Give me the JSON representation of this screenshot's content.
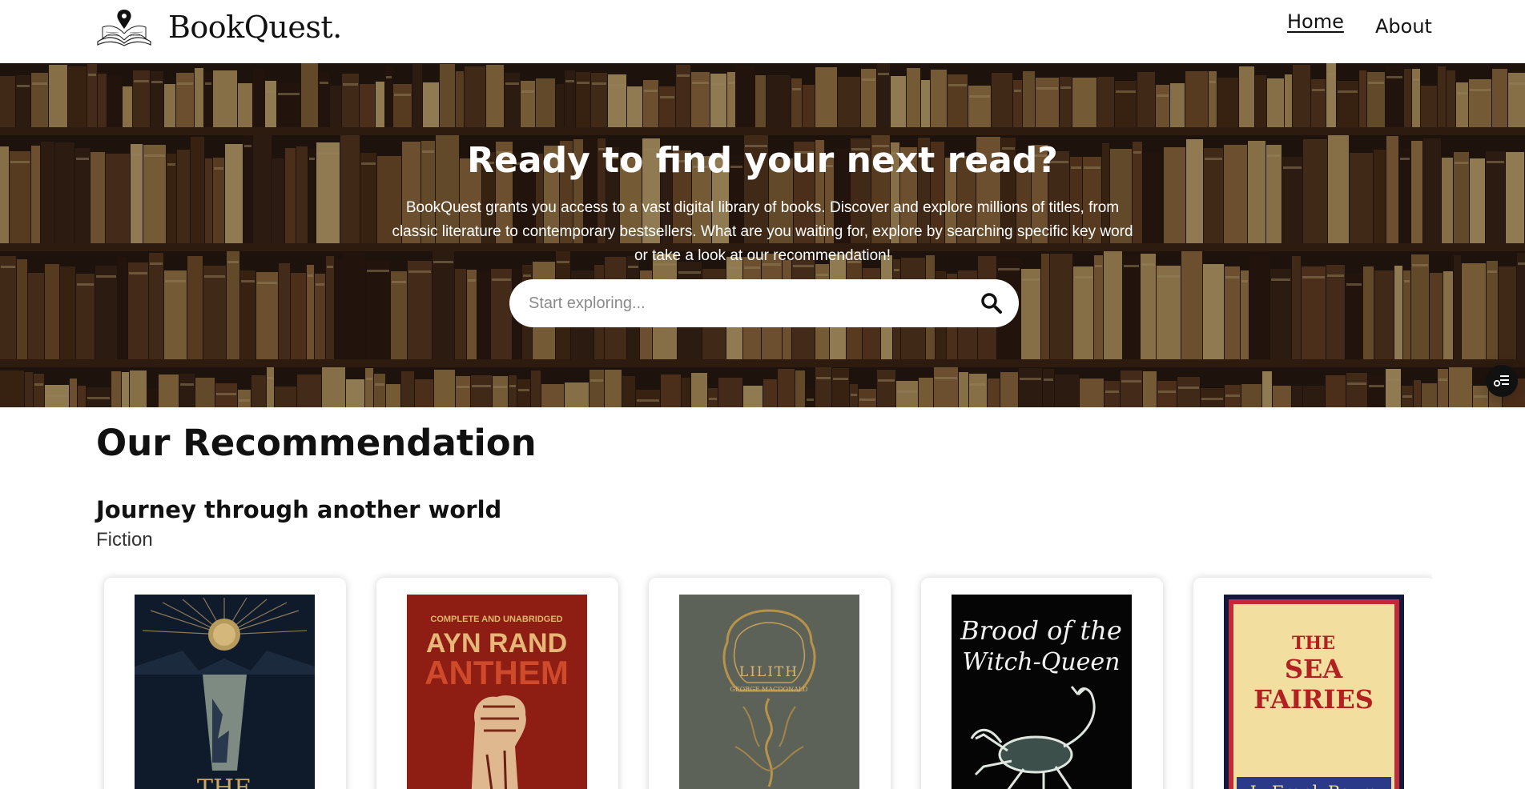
{
  "navbar": {
    "brand_name": "BookQuest.",
    "links": [
      {
        "label": "Home"
      },
      {
        "label": "About"
      }
    ]
  },
  "hero": {
    "title": "Ready to find your next read?",
    "description": "BookQuest grants you access to a vast digital library of books. Discover and explore millions of titles, from classic literature to contemporary bestsellers. What are you waiting for, explore by searching specific key word or take a look at our recommendation!",
    "search": {
      "placeholder": "Start exploring...",
      "value": ""
    }
  },
  "recommendation": {
    "title": "Our Recommendation",
    "group": {
      "title": "Journey through another world",
      "subtitle": "Fiction"
    },
    "books": [
      {
        "cover_text": [
          "THE"
        ],
        "cover_color": "#0f1a2b"
      },
      {
        "cover_text": [
          "COMPLETE AND UNABRIDGED",
          "AYN RAND",
          "ANTHEM"
        ],
        "cover_color": "#8e1d14"
      },
      {
        "cover_text": [
          "LILITH",
          "GEORGE MACDONALD"
        ],
        "cover_color": "#5d6258"
      },
      {
        "cover_text": [
          "Brood of the",
          "Witch-Queen"
        ],
        "cover_color": "#050505"
      },
      {
        "cover_text": [
          "THE",
          "SEA",
          "FAIRIES",
          "L. Frank Baum"
        ],
        "cover_color": "#f2dfa0"
      }
    ]
  },
  "colors": {
    "accent": "#111111",
    "hero_overlay": "#2b1c12",
    "card_bg": "#ffffff"
  },
  "icons": [
    "map-pin-book-logo",
    "search-icon",
    "filter-icon"
  ]
}
